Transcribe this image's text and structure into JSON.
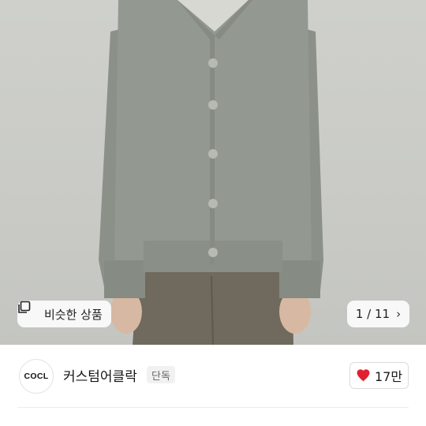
{
  "hero": {
    "similar_label": "비슷한 상품",
    "similar_icon": "copy-icon",
    "counter": "1 / 11",
    "next_icon": "chevron-right-icon"
  },
  "seller": {
    "avatar_text": "COCL",
    "name": "커스텀어클락",
    "badge": "단독"
  },
  "like": {
    "icon": "heart-icon",
    "count": "17만",
    "color": "#e0202e"
  }
}
